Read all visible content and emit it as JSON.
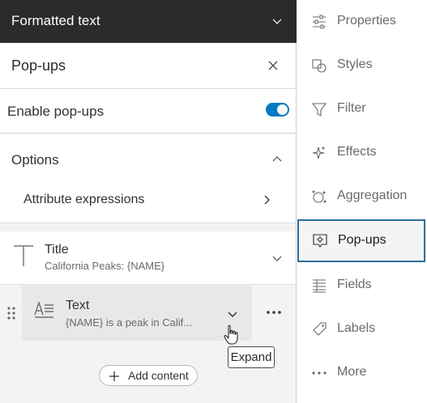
{
  "topbar": {
    "title": "Formatted text"
  },
  "panel": {
    "title": "Pop-ups",
    "enable_label": "Enable pop-ups",
    "enabled": true
  },
  "options": {
    "label": "Options",
    "attribute_expressions": "Attribute expressions"
  },
  "elements": {
    "title": {
      "name": "Title",
      "value": "California Peaks: {NAME}"
    },
    "text": {
      "name": "Text",
      "value": "{NAME} is a peak in Calif..."
    }
  },
  "tooltip": "Expand",
  "add_content": "Add content",
  "nav": [
    {
      "label": "Properties",
      "icon": "properties-sliders-icon"
    },
    {
      "label": "Styles",
      "icon": "styles-shapes-icon"
    },
    {
      "label": "Filter",
      "icon": "filter-icon"
    },
    {
      "label": "Effects",
      "icon": "effects-sparkle-icon"
    },
    {
      "label": "Aggregation",
      "icon": "aggregation-icon"
    },
    {
      "label": "Pop-ups",
      "icon": "popup-icon",
      "active": true
    },
    {
      "label": "Fields",
      "icon": "fields-icon"
    },
    {
      "label": "Labels",
      "icon": "label-tag-icon"
    },
    {
      "label": "More",
      "icon": "more-dots-icon"
    }
  ],
  "colors": {
    "accent": "#007ac2",
    "active_border": "#2c6f9c",
    "topbar_bg": "#2b2b2b"
  }
}
